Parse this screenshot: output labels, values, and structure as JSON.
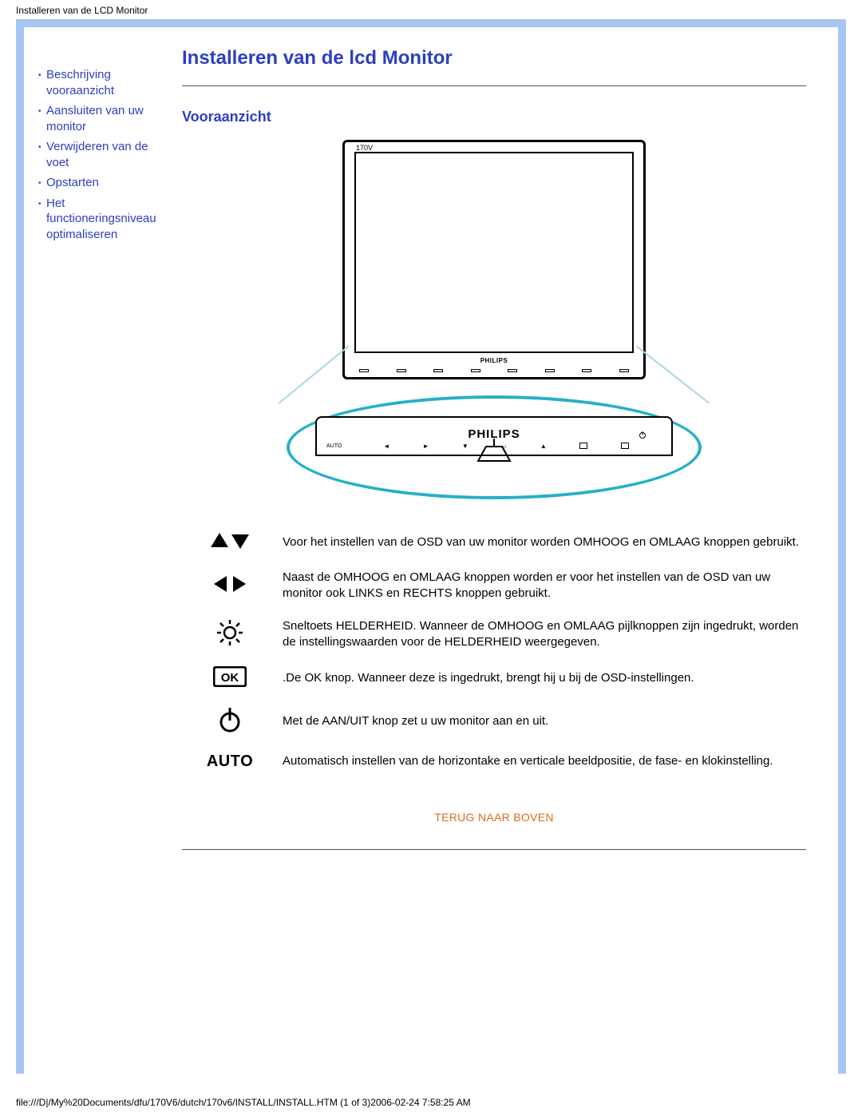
{
  "header_path": "Installeren van de LCD Monitor",
  "sidebar": {
    "items": [
      {
        "label": "Beschrijving vooraanzicht"
      },
      {
        "label": "Aansluiten van uw monitor"
      },
      {
        "label": "Verwijderen van de voet"
      },
      {
        "label": "Opstarten"
      },
      {
        "label": "Het functioneringsniveau optimaliseren"
      }
    ]
  },
  "main": {
    "title": "Installeren van de lcd Monitor",
    "section_heading": "Vooraanzicht",
    "brand": "PHILIPS",
    "model_badge": "170V",
    "panel_auto": "AUTO"
  },
  "rows": [
    {
      "desc": "Voor het instellen van de OSD van uw monitor worden OMHOOG en OMLAAG knoppen gebruikt."
    },
    {
      "desc": "Naast de OMHOOG en OMLAAG knoppen worden er voor het instellen van de OSD van uw monitor ook LINKS en RECHTS knoppen gebruikt."
    },
    {
      "desc": "Sneltoets HELDERHEID. Wanneer de OMHOOG en OMLAAG pijlknoppen zijn ingedrukt, worden de instellingswaarden voor de HELDERHEID weergegeven."
    },
    {
      "desc": ".De OK knop. Wanneer deze is ingedrukt, brengt hij u bij de OSD-instellingen."
    },
    {
      "desc": "Met de AAN/UIT knop zet u uw monitor aan en uit."
    },
    {
      "desc": "Automatisch instellen van de horizontake en verticale beeldpositie, de fase- en klokinstelling."
    }
  ],
  "auto_label": "AUTO",
  "back_to_top": "TERUG NAAR BOVEN",
  "footer_path": "file:///D|/My%20Documents/dfu/170V6/dutch/170v6/INSTALL/INSTALL.HTM (1 of 3)2006-02-24 7:58:25 AM"
}
